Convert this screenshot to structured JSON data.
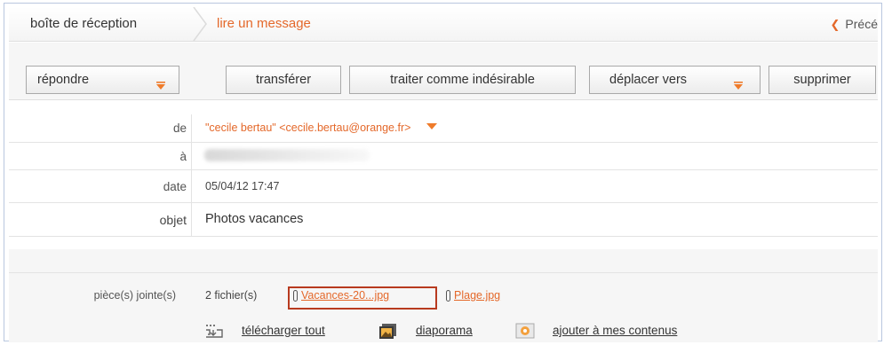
{
  "breadcrumb": {
    "inbox": "boîte de réception",
    "current": "lire un message",
    "previous": "Précé"
  },
  "toolbar": {
    "reply": "répondre",
    "forward": "transférer",
    "spam": "traiter comme indésirable",
    "move": "déplacer vers",
    "delete": "supprimer"
  },
  "message": {
    "from_label": "de",
    "from_value": "\"cecile bertau\" <cecile.bertau@orange.fr>",
    "to_label": "à",
    "date_label": "date",
    "date_value": "05/04/12 17:47",
    "subject_label": "objet",
    "subject_value": "Photos vacances"
  },
  "attachments": {
    "label": "pièce(s) jointe(s)",
    "count": "2 fichier(s)",
    "files": [
      "Vacances-20...jpg",
      "Plage.jpg"
    ],
    "actions": {
      "download_all": "télécharger tout",
      "slideshow": "diaporama",
      "add_to_content": "ajouter à mes contenus"
    }
  },
  "colors": {
    "accent": "#e4682a",
    "highlight_box": "#b83a1f"
  },
  "icons": [
    "arrow-left-icon",
    "dropdown-triangle-icon",
    "paperclip-icon",
    "download-icon",
    "slideshow-icon",
    "add-content-icon"
  ]
}
